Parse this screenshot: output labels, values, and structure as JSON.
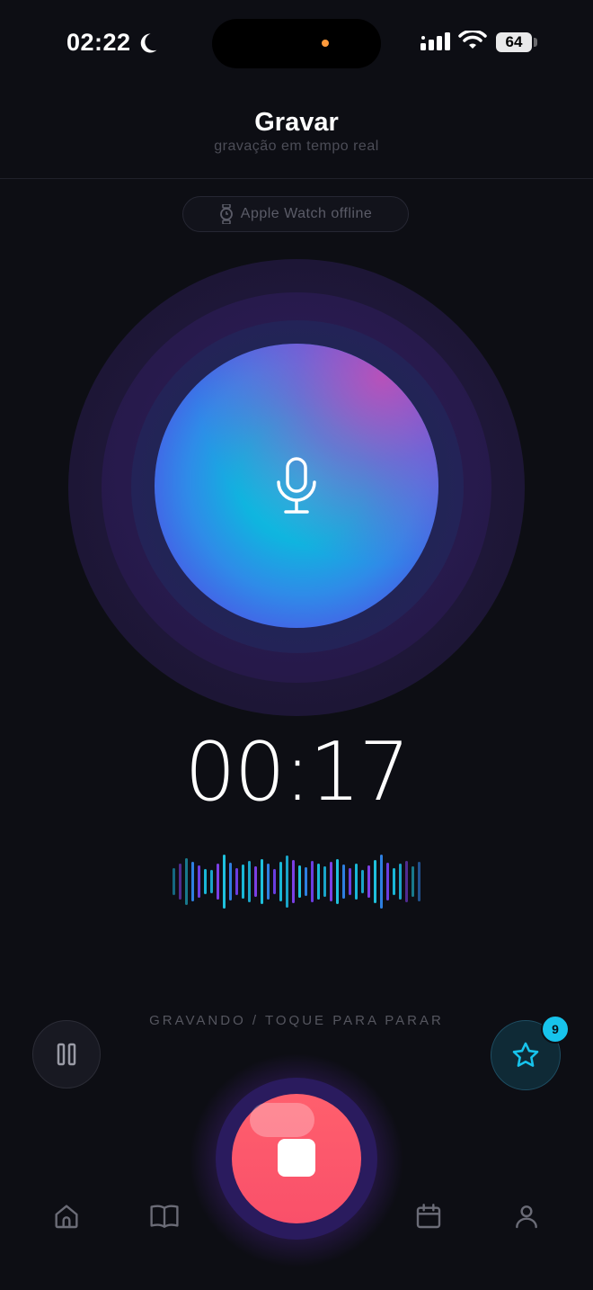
{
  "status_bar": {
    "time": "02:22",
    "battery": "64",
    "icons": [
      "moon-icon",
      "signal-icon",
      "wifi-icon",
      "battery-icon"
    ]
  },
  "header": {
    "title": "Gravar",
    "subtitle": "gravação em tempo real"
  },
  "watch_status": {
    "icon": "watch-icon",
    "label": "Apple Watch offline"
  },
  "recorder": {
    "icon": "microphone-icon",
    "elapsed": "00:17",
    "status_text": "GRAVANDO / TOQUE PARA PARAR"
  },
  "controls": {
    "pause_icon": "pause-icon",
    "favorite_icon": "star-icon",
    "favorite_count": "9",
    "stop_icon": "stop-icon"
  },
  "tab_bar": {
    "items": [
      "home-icon",
      "book-icon",
      "calendar-icon",
      "person-icon"
    ]
  },
  "colors": {
    "background": "#0d0e14",
    "accent_cyan": "#17c3ec",
    "record_red": "#ff5f6d",
    "orb_purple": "#4b48e0"
  }
}
